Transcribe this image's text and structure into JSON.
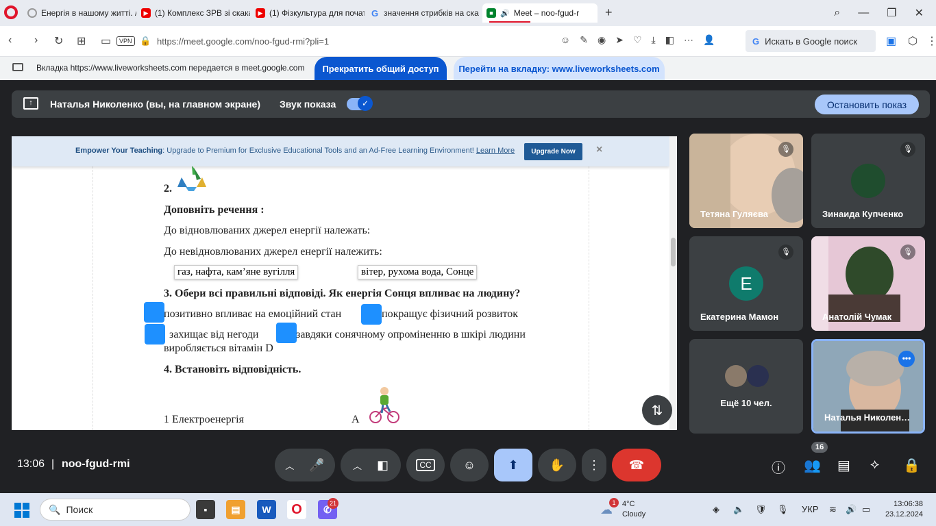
{
  "browser": {
    "tabs": [
      {
        "title": "Енергія в нашому житті. /",
        "favicon": "loading-icon"
      },
      {
        "title": "(1) Комплекс ЗРВ зі скака",
        "favicon": "youtube-icon"
      },
      {
        "title": "(1) Фізкультура для почат",
        "favicon": "youtube-icon"
      },
      {
        "title": "значення стрибків на ска",
        "favicon": "google-icon"
      },
      {
        "title": "Meet – noo-fgud-r",
        "favicon": "meet-icon"
      }
    ],
    "new_tab": "+",
    "url": "https://meet.google.com/noo-fgud-rmi?pli=1",
    "vpn_label": "VPN",
    "search_label": "Искать в Google поиск"
  },
  "share_notice": {
    "text": "Вкладка https://www.liveworksheets.com передается в meet.google.com",
    "stop_button": "Прекратить общий доступ",
    "goto_button": "Перейти на вкладку: www.liveworksheets.com"
  },
  "presentation": {
    "presenter": "Наталья Николенко (вы, на главном экране)",
    "sound_label": "Звук показа",
    "sound_on": true,
    "stop_button": "Остановить показ"
  },
  "worksheet": {
    "banner": {
      "lead": "Empower Your Teaching",
      "text": ": Upgrade to Premium for Exclusive Educational Tools and an Ad-Free Learning Environment! ",
      "link": "Learn More",
      "button": "Upgrade Now",
      "close": "×"
    },
    "section2_num": "2.",
    "complete_title": "Доповніть речення :",
    "line_renewable": "До відновлюваних джерел енергії належать:",
    "line_nonrenewable": "До невідновлюваних джерел енергії належить:",
    "chip_1": "газ, нафта, кам’яне вугілля",
    "chip_2": "вітер, рухома вода, Сонце",
    "q3": "3. Обери всі правильні відповіді.   Як енергія Сонця впливає на людину?",
    "opt_1": "позитивно впливає на емоційний стан",
    "opt_2": "покращує фізичний розвиток",
    "opt_3": "захищає  від  негоди",
    "opt_4": "завдяки  сонячному  опроміненню  в  шкірі  людини",
    "opt_4b": "виробляється вітамін D",
    "q4": "4. Встановіть відповідність.",
    "match_left": "1 Електроенергія",
    "match_right": "А"
  },
  "participants": [
    {
      "name": "Тетяна Гуляєва",
      "muted": true
    },
    {
      "name": "Зинаида Купченко",
      "muted": true
    },
    {
      "name": "Екатерина Мамон",
      "muted": true,
      "initial": "Е",
      "color": "#0f7b6c"
    },
    {
      "name": "Анатолій Чумак",
      "muted": true
    },
    {
      "name": "Ещё 10 чел."
    },
    {
      "name": "Наталья Николен…"
    }
  ],
  "controls": {
    "time": "13:06",
    "separator": "|",
    "meeting_code": "noo-fgud-rmi",
    "people_count": "16"
  },
  "taskbar": {
    "search": "Поиск",
    "viber_badge": "21",
    "weather_badge": "1",
    "temp": "4°C",
    "condition": "Cloudy",
    "lang": "УКР",
    "time": "13:06:38",
    "date": "23.12.2024"
  }
}
